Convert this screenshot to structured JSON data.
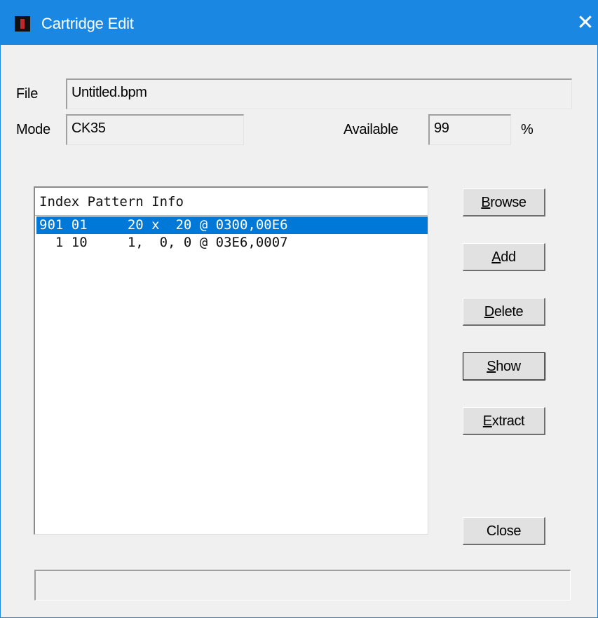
{
  "window": {
    "title": "Cartridge Edit",
    "close_glyph": "✕",
    "icon": "app-icon",
    "titlebar_color": "#1a88e3"
  },
  "fields": {
    "file_label": "File",
    "file_value": "Untitled.bpm",
    "mode_label": "Mode",
    "mode_value": "CK35",
    "available_label": "Available",
    "available_value": "99",
    "percent_label": "%"
  },
  "list": {
    "header": "Index Pattern Info",
    "rows": [
      {
        "text": "901 01     20 x  20 @ 0300,00E6",
        "selected": true
      },
      {
        "text": "  1 10     1,  0, 0 @ 03E6,0007",
        "selected": false
      }
    ],
    "selection_color": "#0078d7"
  },
  "buttons": {
    "browse": {
      "prefix": "",
      "accel": "B",
      "rest": "rowse"
    },
    "add": {
      "prefix": "",
      "accel": "A",
      "rest": "dd"
    },
    "delete": {
      "prefix": "",
      "accel": "D",
      "rest": "elete"
    },
    "show": {
      "prefix": "",
      "accel": "S",
      "rest": "how"
    },
    "extract": {
      "prefix": "",
      "accel": "E",
      "rest": "xtract"
    },
    "close": "Close"
  },
  "status": {
    "text": ""
  }
}
